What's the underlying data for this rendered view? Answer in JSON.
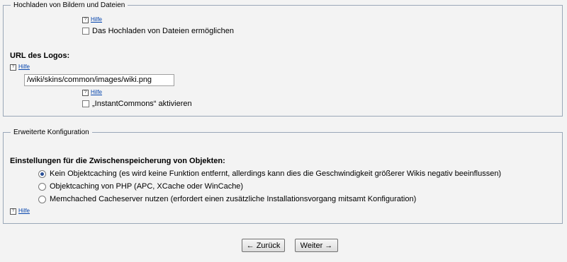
{
  "upload_section": {
    "legend": "Hochladen von Bildern und Dateien",
    "help_label": "Hilfe",
    "enable_upload_label": "Das Hochladen von Dateien ermöglichen",
    "logo_label": "URL des Logos:",
    "logo_value": "/wiki/skins/common/images/wiki.png",
    "instantcommons_label": "„InstantCommons“ aktivieren"
  },
  "advanced_section": {
    "legend": "Erweiterte Konfiguration",
    "caching_heading": "Einstellungen für die Zwischenspeicherung von Objekten:",
    "options": [
      "Kein Objektcaching (es wird keine Funktion entfernt, allerdings kann dies die Geschwindigkeit größerer Wikis negativ beeinflussen)",
      "Objektcaching von PHP (APC, XCache oder WinCache)",
      "Memchached Cacheserver nutzen (erfordert einen zusätzliche Installationsvorgang mitsamt Konfiguration)"
    ],
    "selected_option": 0,
    "help_label": "Hilfe"
  },
  "buttons": {
    "back": "← Zurück",
    "next": "Weiter →"
  },
  "icons": {
    "help": "question-mark-icon"
  }
}
